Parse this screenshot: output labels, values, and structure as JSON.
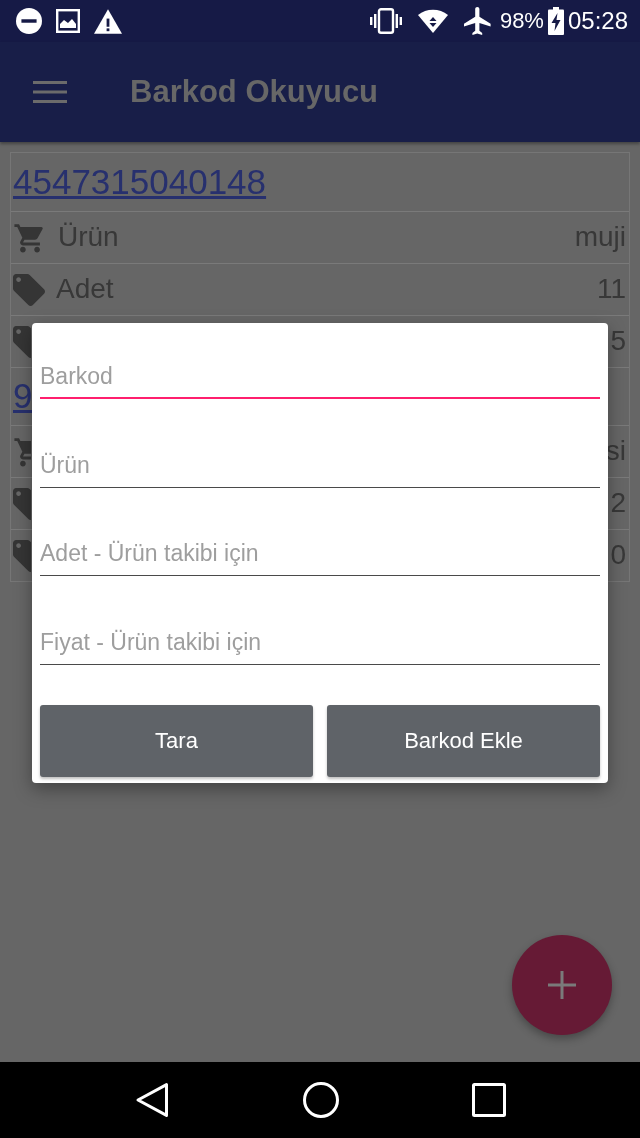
{
  "status_bar": {
    "battery": "98%",
    "time": "05:28"
  },
  "app_bar": {
    "title": "Barkod Okuyucu"
  },
  "products": [
    {
      "barcode": "4547315040148",
      "rows": [
        {
          "kind": "cart",
          "label": "Ürün",
          "value": "muji"
        },
        {
          "kind": "tag",
          "label": "Adet",
          "value": "11"
        },
        {
          "kind": "tag",
          "value": "5"
        }
      ]
    },
    {
      "barcode": "9",
      "rows": [
        {
          "kind": "cart",
          "value": "si"
        },
        {
          "kind": "tag",
          "value": "2"
        },
        {
          "kind": "tag",
          "value": "0"
        }
      ]
    }
  ],
  "dialog": {
    "fields": [
      {
        "placeholder": "Barkod",
        "focused": true
      },
      {
        "placeholder": "Ürün",
        "focused": false
      },
      {
        "placeholder": "Adet - Ürün takibi için",
        "focused": false
      },
      {
        "placeholder": "Fiyat - Ürün takibi için",
        "focused": false
      }
    ],
    "buttons": [
      "Tara",
      "Barkod Ekle"
    ]
  }
}
